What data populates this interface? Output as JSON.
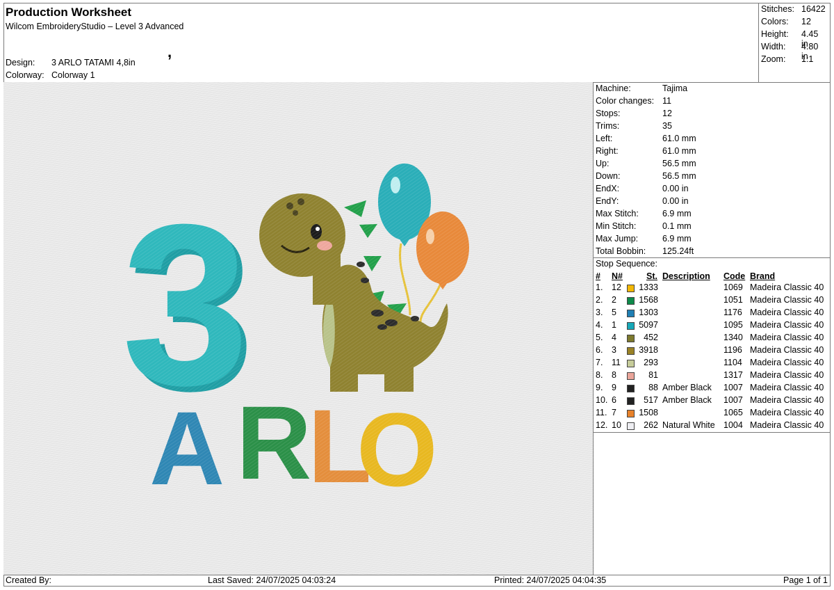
{
  "header": {
    "title": "Production Worksheet",
    "subtitle": "Wilcom EmbroideryStudio – Level 3 Advanced",
    "mark": ",",
    "design_label": "Design:",
    "design_value": "3 ARLO TATAMI 4,8in",
    "colorway_label": "Colorway:",
    "colorway_value": "Colorway 1"
  },
  "summary": [
    {
      "label": "Stitches:",
      "value": "16422"
    },
    {
      "label": "Colors:",
      "value": "12"
    },
    {
      "label": "Height:",
      "value": "4.45 in"
    },
    {
      "label": "Width:",
      "value": "4.80 in"
    },
    {
      "label": "Zoom:",
      "value": "1:1"
    }
  ],
  "machine_info": [
    {
      "label": "Machine:",
      "value": "Tajima"
    },
    {
      "label": "Color changes:",
      "value": "11"
    },
    {
      "label": "Stops:",
      "value": "12"
    },
    {
      "label": "Trims:",
      "value": "35"
    },
    {
      "label": "Left:",
      "value": "61.0 mm"
    },
    {
      "label": "Right:",
      "value": "61.0 mm"
    },
    {
      "label": "Up:",
      "value": "56.5 mm"
    },
    {
      "label": "Down:",
      "value": "56.5 mm"
    },
    {
      "label": "EndX:",
      "value": "0.00 in"
    },
    {
      "label": "EndY:",
      "value": "0.00 in"
    },
    {
      "label": "Max Stitch:",
      "value": "6.9 mm"
    },
    {
      "label": "Min Stitch:",
      "value": "0.1 mm"
    },
    {
      "label": "Max Jump:",
      "value": "6.9 mm"
    },
    {
      "label": "Total Bobbin:",
      "value": "125.24ft"
    }
  ],
  "stop_sequence": {
    "title": "Stop Sequence:",
    "headers": {
      "idx": "#",
      "n": "N#",
      "st": "St.",
      "description": "Description",
      "code": "Code",
      "brand": "Brand"
    },
    "rows": [
      {
        "idx": "1.",
        "n": "12",
        "color": "#f2b705",
        "st": "1333",
        "description": "",
        "code": "1069",
        "brand": "Madeira Classic 40"
      },
      {
        "idx": "2.",
        "n": "2",
        "color": "#0e8a4a",
        "st": "1568",
        "description": "",
        "code": "1051",
        "brand": "Madeira Classic 40"
      },
      {
        "idx": "3.",
        "n": "5",
        "color": "#1f7fb4",
        "st": "1303",
        "description": "",
        "code": "1176",
        "brand": "Madeira Classic 40"
      },
      {
        "idx": "4.",
        "n": "1",
        "color": "#17a8b8",
        "st": "5097",
        "description": "",
        "code": "1095",
        "brand": "Madeira Classic 40"
      },
      {
        "idx": "5.",
        "n": "4",
        "color": "#7d7a2e",
        "st": "452",
        "description": "",
        "code": "1340",
        "brand": "Madeira Classic 40"
      },
      {
        "idx": "6.",
        "n": "3",
        "color": "#9a8226",
        "st": "3918",
        "description": "",
        "code": "1196",
        "brand": "Madeira Classic 40"
      },
      {
        "idx": "7.",
        "n": "11",
        "color": "#c6cc9a",
        "st": "293",
        "description": "",
        "code": "1104",
        "brand": "Madeira Classic 40"
      },
      {
        "idx": "8.",
        "n": "8",
        "color": "#eaa59a",
        "st": "81",
        "description": "",
        "code": "1317",
        "brand": "Madeira Classic 40"
      },
      {
        "idx": "9.",
        "n": "9",
        "color": "#222222",
        "st": "88",
        "description": "Amber Black",
        "code": "1007",
        "brand": "Madeira Classic 40"
      },
      {
        "idx": "10.",
        "n": "6",
        "color": "#222222",
        "st": "517",
        "description": "Amber Black",
        "code": "1007",
        "brand": "Madeira Classic 40"
      },
      {
        "idx": "11.",
        "n": "7",
        "color": "#e8822a",
        "st": "1508",
        "description": "",
        "code": "1065",
        "brand": "Madeira Classic 40"
      },
      {
        "idx": "12.",
        "n": "10",
        "color": "#eeeef2",
        "st": "262",
        "description": "Natural White",
        "code": "1004",
        "brand": "Madeira Classic 40"
      }
    ]
  },
  "design_preview": {
    "number": "3",
    "letters": [
      {
        "char": "A",
        "color": "#2f87b4"
      },
      {
        "char": "R",
        "color": "#2b9048"
      },
      {
        "char": "L",
        "color": "#e48e3c"
      },
      {
        "char": "O",
        "color": "#e8b820"
      }
    ]
  },
  "footer": {
    "created_by": "Created By:",
    "last_saved": "Last Saved: 24/07/2025 04:03:24",
    "printed": "Printed: 24/07/2025 04:04:35",
    "page": "Page 1 of 1"
  }
}
